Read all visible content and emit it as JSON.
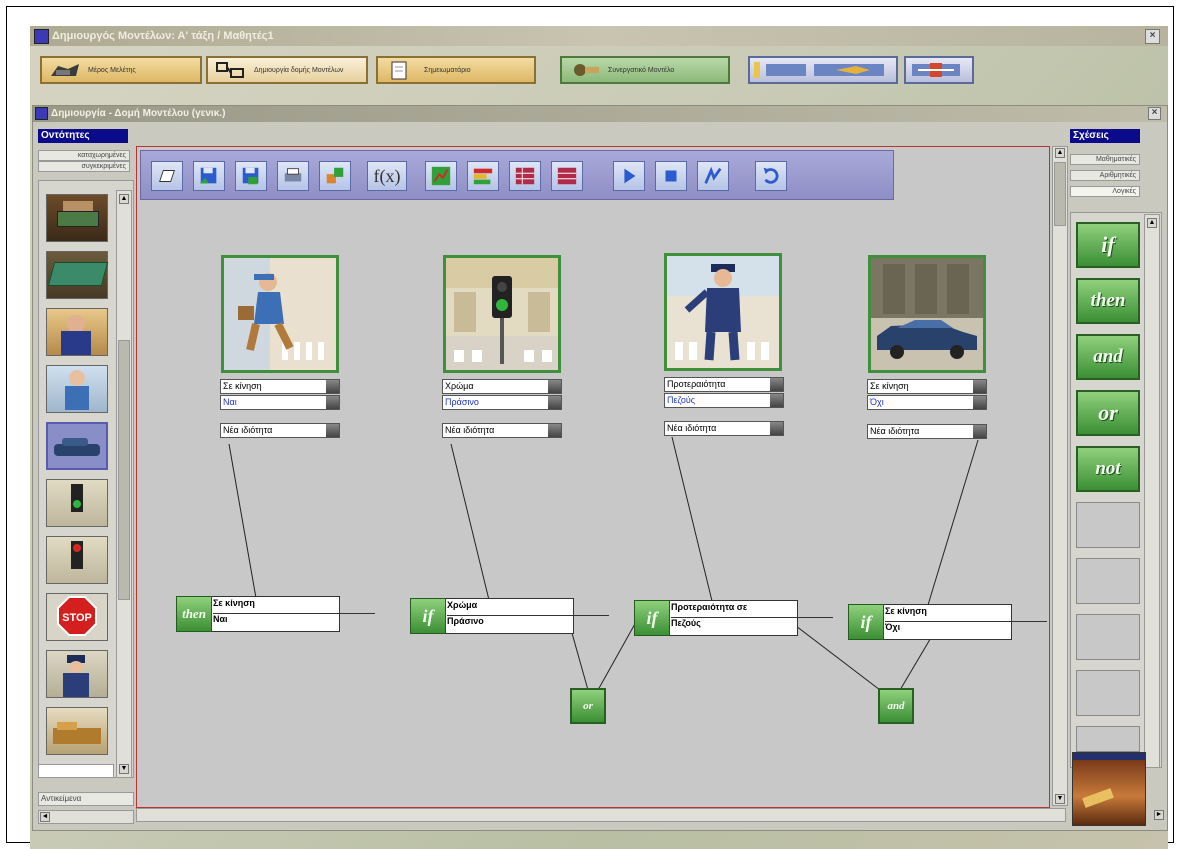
{
  "app_window": {
    "title": "Δημιουργός Μοντέλων: Α' τάξη / Μαθητές1"
  },
  "ribbon": {
    "buttons": [
      {
        "label": "Μέρος Μελέτης",
        "icon": "study-icon"
      },
      {
        "label": "Δημιουργία δομής Μοντέλων",
        "icon": "model-structure-icon"
      },
      {
        "label": "Σημειωματάριο",
        "icon": "notebook-icon"
      },
      {
        "label": "Συνεργατικό Μοντέλο",
        "icon": "collaboration-icon"
      }
    ]
  },
  "inner_window": {
    "title": "Δημιουργία - Δομή Μοντέλου (γενικ.)"
  },
  "left_panel": {
    "header": "Οντότητες",
    "tabs": [
      "καταχωρημένες",
      "συγκεκριμένες"
    ],
    "footer": "Αντικείμενα",
    "items": [
      "room-thumbnail",
      "pool-table-thumbnail",
      "worker-thumbnail",
      "pedestrian-thumbnail",
      "car-thumbnail",
      "traffic-light-green-thumbnail",
      "traffic-light-red-thumbnail",
      "stop-sign-thumbnail",
      "policeman-thumbnail",
      "truck-thumbnail"
    ]
  },
  "right_panel": {
    "header": "Σχέσεις",
    "tabs": [
      "Μαθηματικές",
      "Αριθμητικές",
      "Λογικές"
    ],
    "items": [
      "if",
      "then",
      "and",
      "or",
      "not"
    ]
  },
  "toolbar": {
    "icons": [
      "new-file-icon",
      "save-icon",
      "save-as-icon",
      "print-icon",
      "export-icon",
      "function-icon",
      "graph-icon",
      "bar-chart-icon",
      "table-icon",
      "table-alt-icon",
      "play-icon",
      "stop-icon",
      "step-icon",
      "undo-icon"
    ],
    "function_label": "f(x)"
  },
  "entities": [
    {
      "name": "pedestrian",
      "prop": "Σε κίνηση",
      "val": "Ναι",
      "new_prop": "Νέα ιδιότητα"
    },
    {
      "name": "traffic-light",
      "prop": "Χρώμα",
      "val": "Πράσινο",
      "new_prop": "Νέα ιδιότητα"
    },
    {
      "name": "policeman",
      "prop": "Προτεραιότητα",
      "val": "Πεζούς",
      "new_prop": "Νέα ιδιότητα"
    },
    {
      "name": "car",
      "prop": "Σε κίνηση",
      "val": "Όχι",
      "new_prop": "Νέα ιδιότητα"
    }
  ],
  "logic_nodes": [
    {
      "badge": "then",
      "line1": "Σε κίνηση",
      "line2": "Ναι"
    },
    {
      "badge": "if",
      "line1": "Χρώμα",
      "line2": "Πράσινο"
    },
    {
      "badge": "if",
      "line1": "Προτεραιότητα σε",
      "line2": "Πεζούς"
    },
    {
      "badge": "if",
      "line1": "Σε κίνηση",
      "line2": "Όχι"
    }
  ],
  "operators": [
    "or",
    "and"
  ],
  "colors": {
    "accent_green": "#3f8f3c",
    "panel_header": "#0a0a8a",
    "canvas_border": "#b33333"
  }
}
